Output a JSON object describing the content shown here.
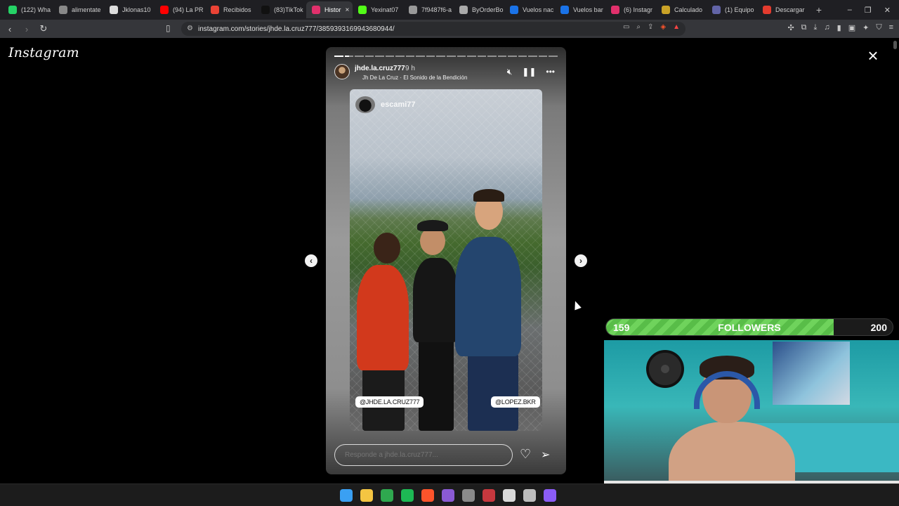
{
  "browser": {
    "tabs": [
      {
        "label": "(122) Wha",
        "color": "#25d366"
      },
      {
        "label": "alimentate",
        "color": "#888888"
      },
      {
        "label": "Jklonas10",
        "color": "#dddddd"
      },
      {
        "label": "(94) La PR",
        "color": "#ff0000"
      },
      {
        "label": "Recibidos",
        "color": "#ea4335"
      },
      {
        "label": "(83)TikTok",
        "color": "#111111"
      },
      {
        "label": "Histor",
        "color": "#e1306c",
        "active": true
      },
      {
        "label": "Yexinat07",
        "color": "#53fc18"
      },
      {
        "label": "7f9487f6-a",
        "color": "#999999"
      },
      {
        "label": "ByOrderBo",
        "color": "#aaaaaa"
      },
      {
        "label": "Vuelos nac",
        "color": "#1a73e8"
      },
      {
        "label": "Vuelos bar",
        "color": "#1a73e8"
      },
      {
        "label": "(6) Instagr",
        "color": "#e1306c"
      },
      {
        "label": "Calculado",
        "color": "#c9a227"
      },
      {
        "label": "(1) Equipo",
        "color": "#6264a7"
      },
      {
        "label": "Descargar",
        "color": "#e33b2e"
      }
    ],
    "url": "instagram.com/stories/jhde.la.cruz777/3859393169943680944/"
  },
  "page": {
    "logo": "Instagram",
    "close_icon": "×"
  },
  "story": {
    "username": "jhde.la.cruz777",
    "time": "9 h",
    "music": "Jh De La Cruz · El Sonido de la Bendición",
    "top_mention": "escami77",
    "tag_left": "@JHDE.LA.CRUZ777",
    "tag_right": "@LOPEZ.BKR",
    "reply_placeholder": "Responde a jhde.la.cruz777...",
    "progress_segments": 22,
    "segments_viewed": 1
  },
  "followers_widget": {
    "current": "159",
    "label": "FOLLOWERS",
    "goal": "200",
    "progress": 0.795,
    "fill_color": "#6fd35c"
  },
  "taskbar": {
    "apps": [
      {
        "name": "windows-start-icon",
        "color": "#3aa0f3"
      },
      {
        "name": "file-explorer-icon",
        "color": "#f4c542"
      },
      {
        "name": "xbox-icon",
        "color": "#2fa84f"
      },
      {
        "name": "spotify-icon",
        "color": "#1db954"
      },
      {
        "name": "brave-icon",
        "color": "#fb542b"
      },
      {
        "name": "visual-studio-icon",
        "color": "#8a5ad4"
      },
      {
        "name": "chrome-like-icon",
        "color": "#8a8a8a"
      },
      {
        "name": "capcut-icon",
        "color": "#c7383e"
      },
      {
        "name": "tool-icon",
        "color": "#d9d9d9"
      },
      {
        "name": "back-app-icon",
        "color": "#bdbdbd"
      },
      {
        "name": "obs-icon",
        "color": "#8b5cf6"
      }
    ]
  }
}
